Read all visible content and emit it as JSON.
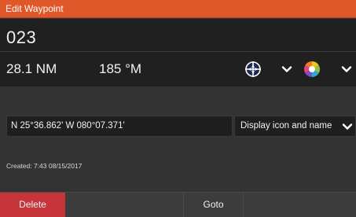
{
  "window": {
    "title": "Edit Waypoint",
    "accent_color": "#e0572a"
  },
  "waypoint": {
    "name": "023",
    "distance": "28.1 NM",
    "bearing": "185 °M",
    "symbol_icon": "waypoint-crosshair-icon",
    "color_icon": "color-wheel-icon",
    "position": "N 25°36.862'   W 080°07.371'",
    "display_mode": "Display icon and name",
    "created": "Created: 7:43   08/15/2017"
  },
  "buttons": {
    "delete_label": "Delete",
    "goto_label": "Goto",
    "delete_color": "#c7353a"
  }
}
